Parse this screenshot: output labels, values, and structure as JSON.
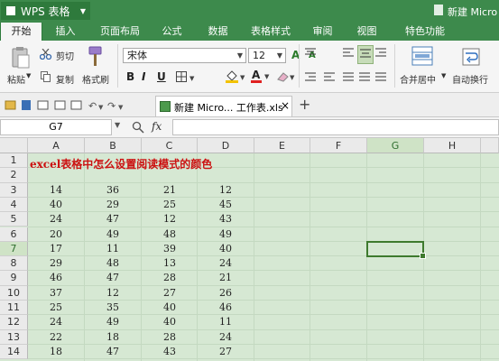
{
  "app": {
    "name": "WPS 表格",
    "doc_title_partial": "新建 Micro"
  },
  "menu": {
    "tabs": [
      "开始",
      "插入",
      "页面布局",
      "公式",
      "数据",
      "表格样式",
      "审阅",
      "视图",
      "特色功能"
    ],
    "active_index": 0
  },
  "ribbon": {
    "paste": "粘贴",
    "cut": "剪切",
    "copy": "复制",
    "format_painter": "格式刷",
    "font_name": "宋体",
    "font_size": "12",
    "merge_center": "合并居中",
    "wrap_text": "自动换行",
    "bold": "B",
    "italic": "I",
    "underline": "U",
    "font_color_letter": "A"
  },
  "tabbar": {
    "file_tab": "新建 Micro... 工作表.xls",
    "close": "×",
    "add": "+"
  },
  "formula_bar": {
    "name_box": "G7",
    "fx": "fx",
    "content": ""
  },
  "sheet": {
    "columns": [
      "A",
      "B",
      "C",
      "D",
      "E",
      "F",
      "G",
      "H"
    ],
    "selected_column": "G",
    "rows": [
      "1",
      "2",
      "3",
      "4",
      "5",
      "6",
      "7",
      "8",
      "9",
      "10",
      "11",
      "12",
      "13",
      "14"
    ],
    "selected_row": "7",
    "title_cell": "excel表格中怎么设置阅读模式的颜色",
    "data": [
      [
        "14",
        "36",
        "21",
        "12"
      ],
      [
        "40",
        "29",
        "25",
        "45"
      ],
      [
        "24",
        "47",
        "12",
        "43"
      ],
      [
        "20",
        "49",
        "48",
        "49"
      ],
      [
        "17",
        "11",
        "39",
        "40"
      ],
      [
        "29",
        "48",
        "13",
        "24"
      ],
      [
        "46",
        "47",
        "28",
        "21"
      ],
      [
        "37",
        "12",
        "27",
        "26"
      ],
      [
        "25",
        "35",
        "40",
        "46"
      ],
      [
        "24",
        "49",
        "40",
        "11"
      ],
      [
        "22",
        "18",
        "28",
        "24"
      ],
      [
        "18",
        "47",
        "43",
        "27"
      ]
    ]
  },
  "colors": {
    "title_bar": "#3d8a4c",
    "reading_mode_fill": "#d6e8d3",
    "selection_border": "#3e7a2e",
    "title_text": "#cc1111"
  }
}
